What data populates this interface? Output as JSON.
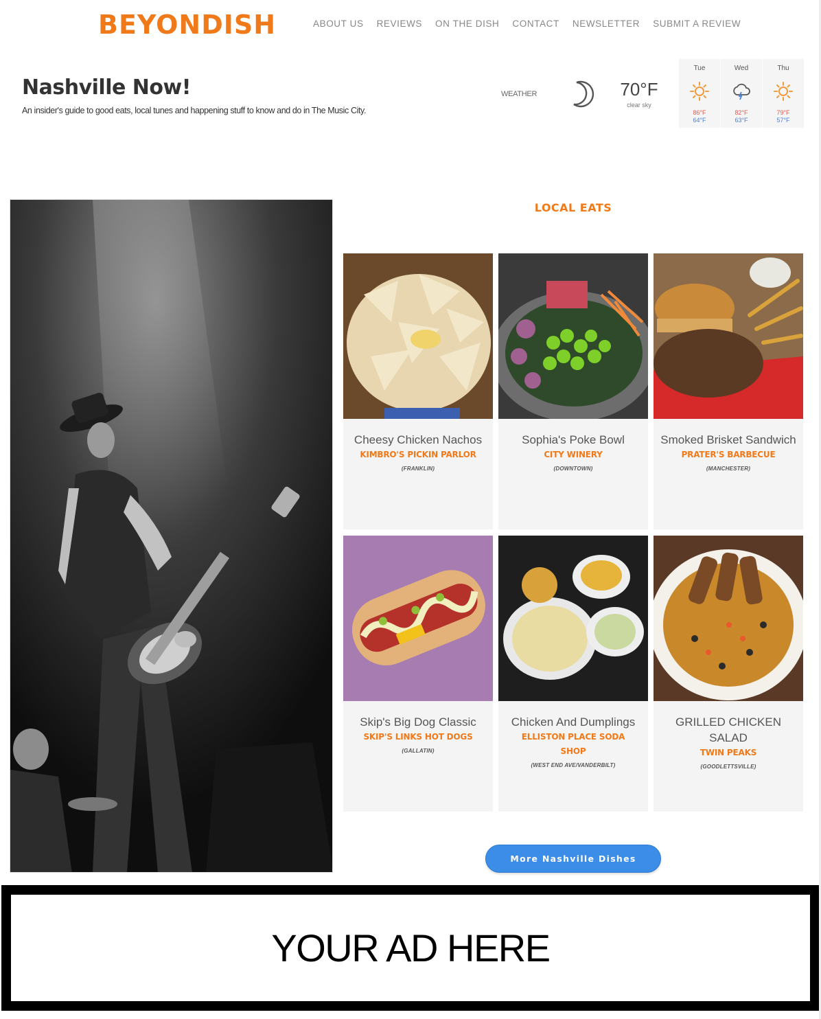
{
  "brand": {
    "logo": "BEYONDISH"
  },
  "nav": [
    {
      "label": "ABOUT US"
    },
    {
      "label": "REVIEWS"
    },
    {
      "label": "ON THE DISH"
    },
    {
      "label": "CONTACT"
    },
    {
      "label": "NEWSLETTER"
    },
    {
      "label": "SUBMIT A REVIEW"
    }
  ],
  "page": {
    "title": "Nashville Now!",
    "subtitle": "An insider's guide to good eats, local tunes and happening stuff to know and do in The Music City."
  },
  "weather": {
    "label": "WEATHER",
    "current_icon": "moon-icon",
    "temp": "70°F",
    "desc": "clear sky",
    "forecast": [
      {
        "day": "Tue",
        "icon": "sun-icon",
        "high": "86°F",
        "low": "64°F"
      },
      {
        "day": "Wed",
        "icon": "rain-cloud-icon",
        "high": "82°F",
        "low": "63°F"
      },
      {
        "day": "Thu",
        "icon": "sun-icon",
        "high": "79°F",
        "low": "57°F"
      }
    ]
  },
  "local_eats": {
    "title": "LOCAL EATS",
    "cards": [
      {
        "name": "Cheesy Chicken Nachos",
        "place": "KIMBRO'S PICKIN PARLOR",
        "location": "(FRANKLIN)"
      },
      {
        "name": "Sophia's Poke Bowl",
        "place": "CITY WINERY",
        "location": "(DOWNTOWN)"
      },
      {
        "name": "Smoked Brisket Sandwich",
        "place": "PRATER'S BARBECUE",
        "location": "(MANCHESTER)"
      },
      {
        "name": "Skip's Big Dog Classic",
        "place": "SKIP'S LINKS HOT DOGS",
        "location": "(GALLATIN)"
      },
      {
        "name": "Chicken And Dumplings",
        "place": "ELLISTON PLACE SODA SHOP",
        "location": "(WEST END AVE/VANDERBILT)"
      },
      {
        "name": "GRILLED CHICKEN SALAD",
        "place": "TWIN PEAKS",
        "location": "(GOODLETTSVILLE)"
      }
    ],
    "more_button": "More Nashville Dishes"
  },
  "ad": {
    "text": "YOUR AD HERE"
  },
  "colors": {
    "accent": "#f07a1a",
    "button": "#3b8de8",
    "high": "#e05a4f",
    "low": "#4a7fd4"
  }
}
